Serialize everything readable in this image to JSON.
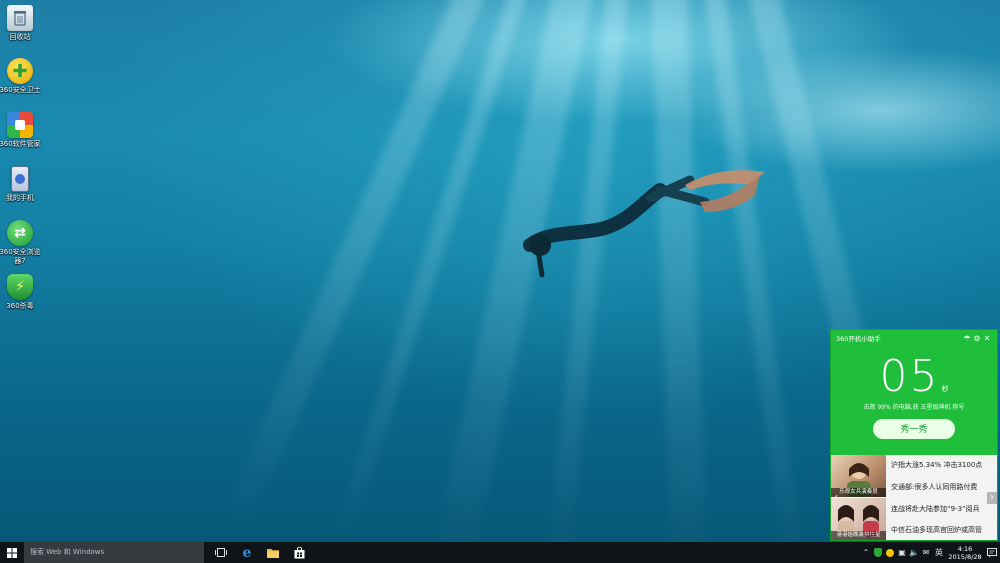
{
  "desktop": {
    "icons": [
      {
        "label": "回收站",
        "icon": "recycle-bin-icon",
        "color": "#dfe8ef"
      },
      {
        "label": "360安全卫士",
        "icon": "360-guard-icon",
        "color": "#f2c500"
      },
      {
        "label": "360软件管家",
        "icon": "360-software-manager-icon",
        "color": "#e84b3a"
      },
      {
        "label": "我的手机",
        "icon": "my-phone-icon",
        "color": "#3b6fd1"
      },
      {
        "label": "360安全浏览器7",
        "icon": "360-browser-icon",
        "color": "#2db84a"
      },
      {
        "label": "360杀毒",
        "icon": "360-antivirus-icon",
        "color": "#2ea83a"
      }
    ]
  },
  "widget": {
    "title": "360开机小助手",
    "seconds": "05",
    "unit": "秒",
    "message": "击败 99% 的电脑,获 五星级神机 称号",
    "button": "秀一秀",
    "news": [
      "沪指大涨5.34% 冲击3100点",
      "交通部:很多人认同用路付费",
      "连战将赴大陆参加“9-3”阅兵",
      "中信石油多现高官回炉或高管"
    ],
    "thumb_captions": [
      "乐视女兵演奏员",
      "港港姐晚装拼住星"
    ],
    "accent": "#1fbf3c"
  },
  "taskbar": {
    "search_placeholder": "搜索 Web 和 Windows",
    "pinned": [
      "task-view-icon",
      "edge-icon",
      "file-explorer-icon",
      "store-icon"
    ],
    "tray": {
      "ime": "英",
      "time": "4:16",
      "date": "2015/8/28"
    }
  }
}
